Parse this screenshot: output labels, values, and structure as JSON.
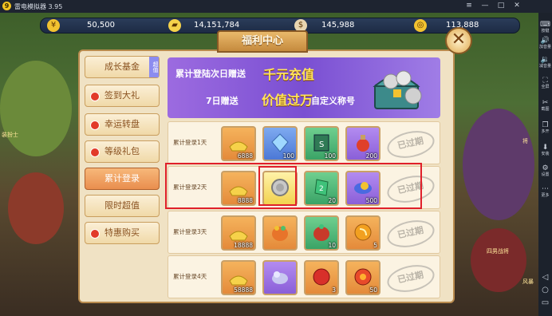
{
  "window": {
    "title": "雷电模拟器 3.95",
    "logo_text": "9"
  },
  "window_buttons": [
    {
      "name": "menu-icon",
      "glyph": "≡"
    },
    {
      "name": "minimize-icon",
      "glyph": "—"
    },
    {
      "name": "maximize-icon",
      "glyph": "□"
    },
    {
      "name": "close-icon",
      "glyph": "✕"
    }
  ],
  "sidebar": [
    {
      "name": "keyboard",
      "label": "按键",
      "glyph": "⌨"
    },
    {
      "name": "volume-up",
      "label": "加音量",
      "glyph": "🔊"
    },
    {
      "name": "volume-down",
      "label": "减音量",
      "glyph": "🔉"
    },
    {
      "name": "fullscreen",
      "label": "全屏",
      "glyph": "⛶"
    },
    {
      "name": "screenshot",
      "label": "截图",
      "glyph": "✂"
    },
    {
      "name": "multi-open",
      "label": "多开",
      "glyph": "❐"
    },
    {
      "name": "install",
      "label": "安装",
      "glyph": "⬇"
    },
    {
      "name": "settings",
      "label": "设置",
      "glyph": "⚙"
    },
    {
      "name": "more",
      "label": "更多",
      "glyph": "⋯"
    }
  ],
  "android_nav": [
    {
      "name": "back-icon",
      "glyph": "◁"
    },
    {
      "name": "home-icon",
      "glyph": "○"
    },
    {
      "name": "recent-icon",
      "glyph": "▭"
    }
  ],
  "resources": [
    {
      "name": "coin",
      "value": "50,500",
      "color": "#f2c230",
      "glyph": "¥"
    },
    {
      "name": "gold-ingot",
      "value": "14,151,784",
      "color": "#f6d24a",
      "glyph": "▰"
    },
    {
      "name": "money-bag",
      "value": "145,988",
      "color": "#e8d5b0",
      "glyph": "$"
    },
    {
      "name": "token",
      "value": "113,888",
      "color": "#f2c230",
      "glyph": "◎"
    }
  ],
  "scene_labels": {
    "left_top": "装扮士",
    "right_top": "将",
    "right_mid": "四男战将",
    "right_low": "风暴"
  },
  "panel": {
    "title": "福利中心",
    "close_glyph": "✕"
  },
  "tabs": [
    {
      "label": "成长基金",
      "dot": false,
      "hot": "超值",
      "active": false
    },
    {
      "label": "签到大礼",
      "dot": true,
      "hot": "",
      "active": false
    },
    {
      "label": "幸运转盘",
      "dot": true,
      "hot": "",
      "active": false
    },
    {
      "label": "等级礼包",
      "dot": true,
      "hot": "",
      "active": false
    },
    {
      "label": "累计登录",
      "dot": false,
      "hot": "",
      "active": true
    },
    {
      "label": "限时超值",
      "dot": false,
      "hot": "",
      "active": false
    },
    {
      "label": "特惠购买",
      "dot": true,
      "hot": "",
      "active": false
    }
  ],
  "banner": {
    "line1_a": "累计登陆次日赠送",
    "line1_b": "千元充值",
    "line2_a": "7日赠送",
    "line2_b": "价值过万",
    "line2_c": "自定义称号"
  },
  "rows": [
    {
      "day": "累计登录1天",
      "stamp": "已过期",
      "items": [
        {
          "icon": "gold-ingot",
          "rarity": "orange",
          "count": "6888"
        },
        {
          "icon": "crystal",
          "rarity": "blue",
          "count": "100"
        },
        {
          "icon": "book",
          "rarity": "green",
          "count": "100"
        },
        {
          "icon": "potion",
          "rarity": "purple",
          "count": "200"
        }
      ]
    },
    {
      "day": "累计登录2天",
      "stamp": "已过期",
      "items": [
        {
          "icon": "gold-ingot",
          "rarity": "orange",
          "count": "8888"
        },
        {
          "icon": "silver-coin",
          "rarity": "gold",
          "count": ""
        },
        {
          "icon": "green-gem",
          "rarity": "green",
          "count": "20"
        },
        {
          "icon": "scroll",
          "rarity": "purple",
          "count": "500"
        }
      ]
    },
    {
      "day": "累计登录3天",
      "stamp": "已过期",
      "items": [
        {
          "icon": "gold-ingot",
          "rarity": "orange",
          "count": "18888"
        },
        {
          "icon": "treasure-bag",
          "rarity": "orange",
          "count": ""
        },
        {
          "icon": "gift-bag",
          "rarity": "green",
          "count": "10"
        },
        {
          "icon": "gold-orb",
          "rarity": "orange",
          "count": "5"
        }
      ]
    },
    {
      "day": "累计登录4天",
      "stamp": "已过期",
      "items": [
        {
          "icon": "gold-ingot",
          "rarity": "orange",
          "count": "58888"
        },
        {
          "icon": "pet",
          "rarity": "purple",
          "count": ""
        },
        {
          "icon": "red-orb",
          "rarity": "orange",
          "count": "3"
        },
        {
          "icon": "fire-orb",
          "rarity": "orange",
          "count": "50"
        }
      ]
    }
  ]
}
